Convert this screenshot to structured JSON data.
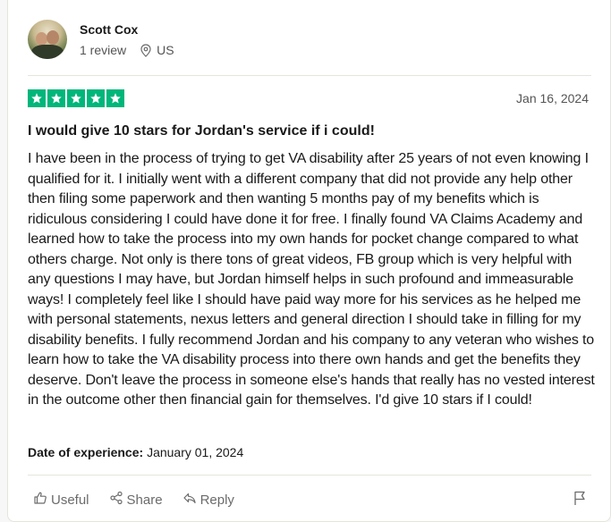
{
  "review": {
    "user": {
      "name": "Scott Cox",
      "reviews": "1 review",
      "country": "US"
    },
    "rating": 5,
    "date": "Jan 16, 2024",
    "title": "I would give 10 stars for Jordan's service if i could!",
    "body": "I have been in the process of trying to get VA disability after 25 years of not even knowing I qualified for it. I initially went with a different company that did not provide any help other then filing some paperwork and then wanting 5 months pay of my benefits which is ridiculous considering I could have done it for free. I finally found VA Claims Academy and learned how to take the process into my own hands for pocket change compared to what others charge. Not only is there tons of great videos, FB group which is very helpful with any questions I may have, but Jordan himself helps in such profound and immeasurable ways! I completely feel like I should have paid way more for his services as he helped me with personal statements, nexus letters and general direction I should take in filling for my disability benefits. I fully recommend Jordan and his company to any veteran who wishes to learn how to take the VA disability process into there own hands and get the benefits they deserve. Don't leave the process in someone else's hands that really has no vested interest in the outcome other then financial gain for themselves. I'd give 10 stars if I could!",
    "experience_label": "Date of experience:",
    "experience_date": "January 01, 2024"
  },
  "actions": {
    "useful": "Useful",
    "share": "Share",
    "reply": "Reply"
  },
  "colors": {
    "star_green": "#00b67a",
    "divider": "#e5e5dd"
  }
}
